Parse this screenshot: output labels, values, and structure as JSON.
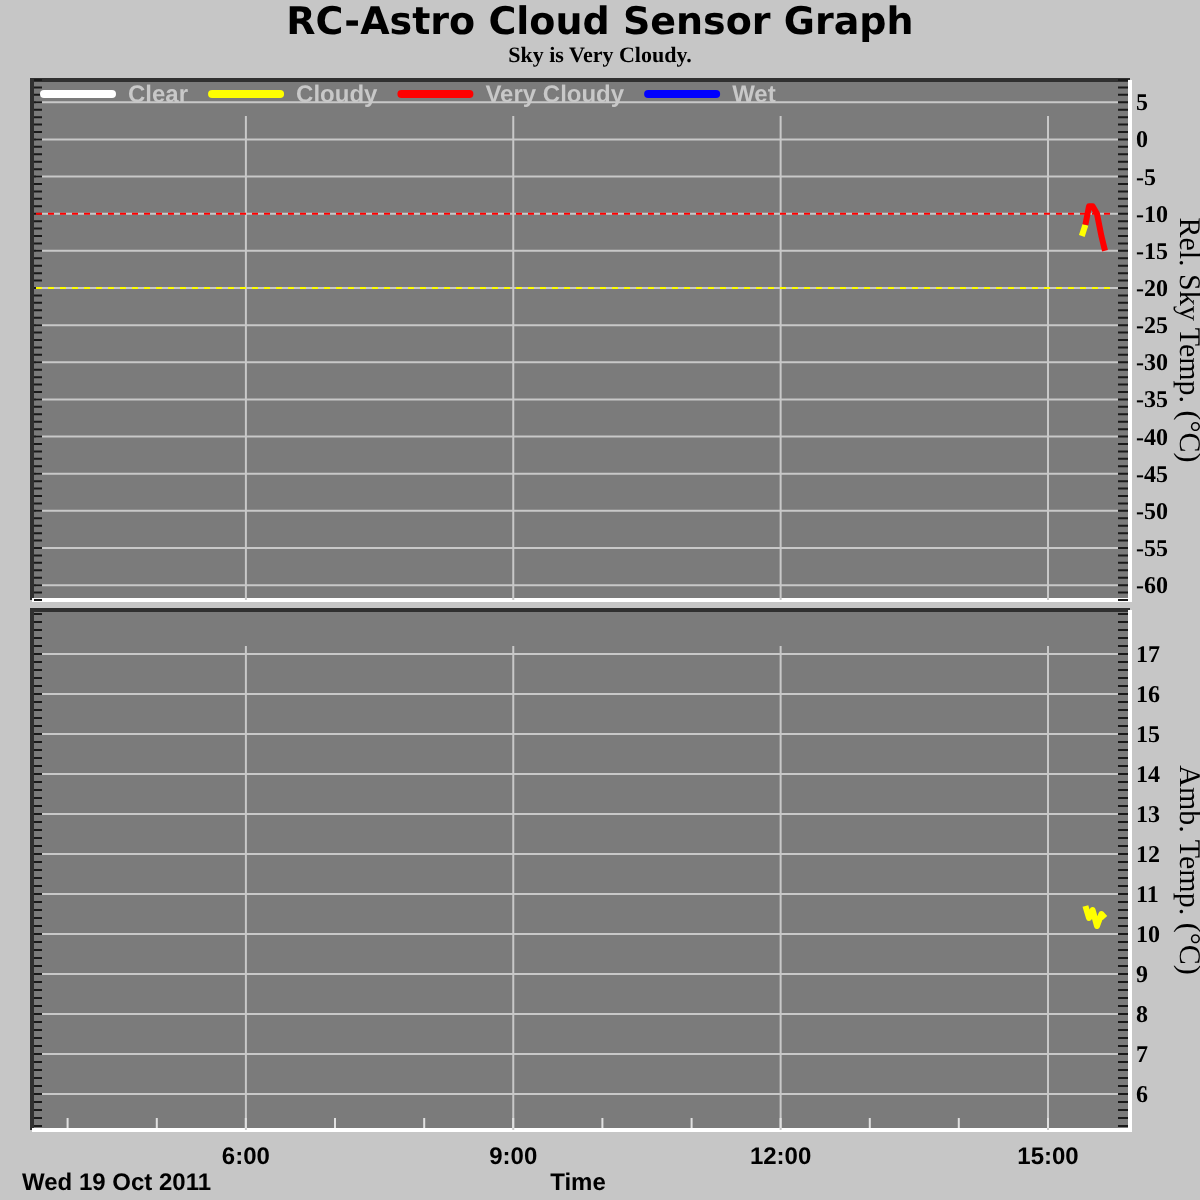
{
  "title": "RC-Astro Cloud Sensor Graph",
  "subtitle": "Sky is Very Cloudy.",
  "charts": [
    {
      "chart_data": {
        "type": "line",
        "legend": "top",
        "ylabel": "Rel. Sky Temp. (°C)",
        "grid": true,
        "x": [
          15.38,
          15.42,
          15.46,
          15.5,
          15.55,
          15.6,
          15.64
        ],
        "xlim": [
          3.6,
          15.92
        ],
        "ylim": [
          -62,
          8
        ],
        "yticks": [
          5,
          0,
          -5,
          -10,
          -15,
          -20,
          -25,
          -30,
          -35,
          -40,
          -45,
          -50,
          -55,
          -60
        ],
        "series": [
          {
            "name": "Clear",
            "color": "#ffffff",
            "values": [
              null,
              null,
              null,
              null,
              null,
              null,
              null
            ]
          },
          {
            "name": "Cloudy",
            "color": "#ffff00",
            "values": [
              -13,
              -11.5,
              null,
              null,
              null,
              null,
              null
            ]
          },
          {
            "name": "Very Cloudy",
            "color": "#ff0000",
            "values": [
              null,
              -11.5,
              -9,
              -9,
              -10,
              -13,
              -15
            ]
          },
          {
            "name": "Wet",
            "color": "#0000ff",
            "values": [
              null,
              null,
              null,
              null,
              null,
              null,
              null
            ]
          }
        ],
        "ref_lines": [
          {
            "axis": "y",
            "value": -10,
            "color": "#ff0000"
          },
          {
            "axis": "y",
            "value": -20,
            "color": "#ffff00"
          }
        ]
      }
    },
    {
      "chart_data": {
        "type": "line",
        "xlabel": "Time",
        "grid": true,
        "ylabel": "Amb. Temp. (°C)",
        "x": [
          15.42,
          15.46,
          15.5,
          15.55,
          15.6,
          15.64
        ],
        "xlim": [
          3.6,
          15.92
        ],
        "ylim": [
          5.1,
          18.1
        ],
        "xticks": [
          {
            "value": 6,
            "label": "6:00"
          },
          {
            "value": 9,
            "label": "9:00"
          },
          {
            "value": 12,
            "label": "12:00"
          },
          {
            "value": 15,
            "label": "15:00"
          }
        ],
        "yticks": [
          17,
          16,
          15,
          14,
          13,
          12,
          11,
          10,
          9,
          8,
          7,
          6
        ],
        "series": [
          {
            "color": "#ffff00",
            "values": [
              10.7,
              10.4,
              10.6,
              10.2,
              10.5,
              10.4
            ]
          }
        ]
      }
    }
  ],
  "date": "Wed 19 Oct 2011"
}
